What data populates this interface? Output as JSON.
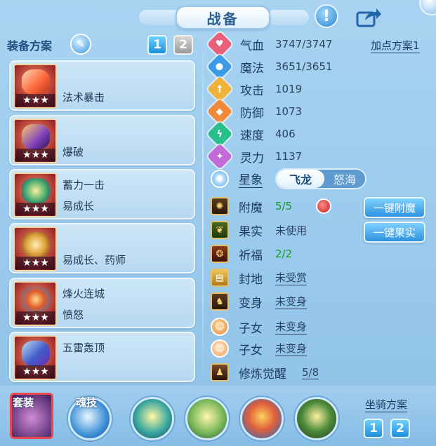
{
  "title": "战备",
  "equip": {
    "scheme_label": "装备方案",
    "tabs": [
      "1",
      "2"
    ],
    "cards": [
      {
        "lines": [
          "",
          "法术暴击"
        ],
        "stars": "★★★"
      },
      {
        "lines": [
          "",
          "爆破"
        ],
        "stars": "★★★"
      },
      {
        "lines": [
          "蓄力一击",
          "易成长"
        ],
        "stars": "★★★"
      },
      {
        "lines": [
          "",
          "易成长、药师"
        ],
        "stars": "★★★"
      },
      {
        "lines": [
          "烽火连城",
          "愤怒"
        ],
        "stars": "★★★"
      },
      {
        "lines": [
          "五雷轰顶",
          ""
        ],
        "stars": "★★★"
      }
    ]
  },
  "stats": {
    "plan_link": "加点方案1",
    "rows": [
      {
        "name": "气血",
        "value": "3747/3747",
        "color": "#e8607a",
        "icon": "heart-icon",
        "glyph": "♥"
      },
      {
        "name": "魔法",
        "value": "3651/3651",
        "color": "#3b9be6",
        "icon": "mana-icon",
        "glyph": "●"
      },
      {
        "name": "攻击",
        "value": "1019",
        "color": "#f0b33a",
        "icon": "sword-icon",
        "glyph": "†"
      },
      {
        "name": "防御",
        "value": "1073",
        "color": "#f08a3a",
        "icon": "shield-icon",
        "glyph": "◆"
      },
      {
        "name": "速度",
        "value": "406",
        "color": "#27c08a",
        "icon": "lightning-icon",
        "glyph": "ϟ"
      },
      {
        "name": "灵力",
        "value": "1137",
        "color": "#c46ad8",
        "icon": "spirit-icon",
        "glyph": "✦"
      }
    ]
  },
  "star": {
    "label": "星象",
    "options": [
      "飞龙",
      "怒海"
    ]
  },
  "features": [
    {
      "name": "附魔",
      "value": "5/5",
      "style": "green",
      "icon": "enchant-icon"
    },
    {
      "name": "果实",
      "value": "未使用",
      "style": "plain",
      "icon": "fruit-icon"
    },
    {
      "name": "祈福",
      "value": "2/2",
      "style": "green",
      "icon": "blessing-icon"
    },
    {
      "name": "封地",
      "value": "未受赏",
      "style": "link",
      "icon": "fief-icon"
    },
    {
      "name": "变身",
      "value": "未变身",
      "style": "link",
      "icon": "transform-icon"
    },
    {
      "name": "子女",
      "value": "未变身",
      "style": "link",
      "icon": "child-icon"
    },
    {
      "name": "子女",
      "value": "未变身",
      "style": "link",
      "icon": "child-icon"
    },
    {
      "name": "修炼觉醒",
      "value": "5/8",
      "style": "link",
      "icon": "cultivation-icon"
    }
  ],
  "buttons": {
    "enchant": "一键附魔",
    "fruit": "一键果实"
  },
  "bottom": {
    "suit_label": "套装",
    "soul_label": "魂技",
    "mount_label": "坐骑方案",
    "mount_tabs": [
      "1",
      "2"
    ]
  },
  "colors": {
    "accent": "#2f92df",
    "green": "#179a2a",
    "text": "#1e3c5e"
  }
}
